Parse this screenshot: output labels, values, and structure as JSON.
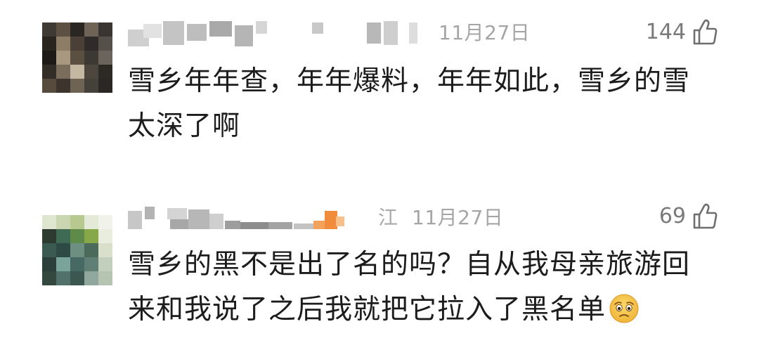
{
  "comments": [
    {
      "timestamp": "11月27日",
      "likes": "144",
      "text_line1": "雪乡年年查，年年爆料，年年如此，雪乡的雪",
      "text_line2": "太深了啊",
      "like_icon": "thumbs-up-outline-icon"
    },
    {
      "username_tail": "江",
      "timestamp": "11月27日",
      "likes": "69",
      "text_line1": "雪乡的黑不是出了名的吗？自从我母亲旅游回",
      "text_line2": "来和我说了之后我就把它拉入了黑名单",
      "emoji": "worried-face-emoji",
      "like_icon": "thumbs-up-outline-icon"
    }
  ],
  "colors": {
    "text": "#1c1c1c",
    "meta": "#a5a5a5",
    "like_count": "#7a7a7a",
    "emoji_face": "#f7c948"
  }
}
